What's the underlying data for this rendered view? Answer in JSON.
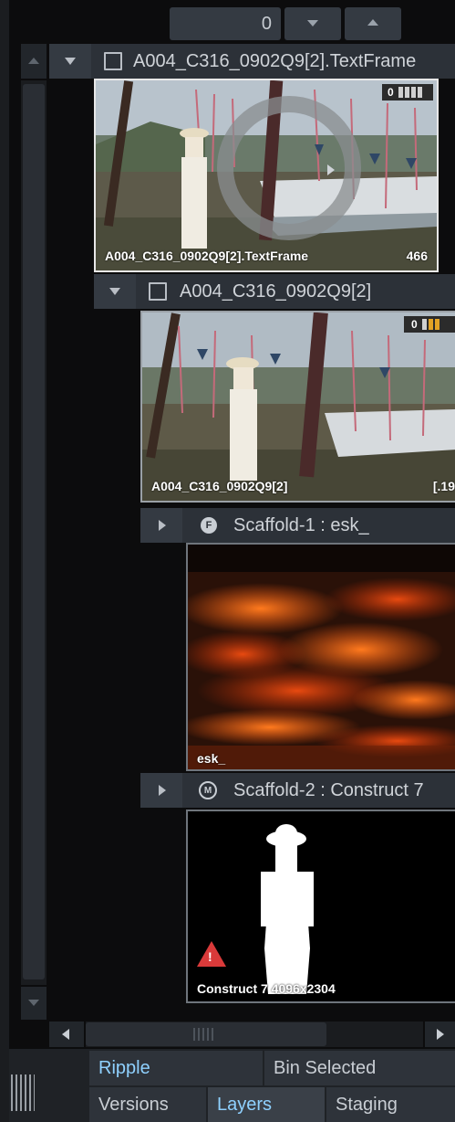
{
  "top_counter": {
    "value": "0"
  },
  "layers": [
    {
      "name": "A004_C316_0902Q9[2].TextFrame",
      "thumb_label": "A004_C316_0902Q9[2].TextFrame",
      "thumb_count": "466",
      "badge_value": "0"
    },
    {
      "name": "A004_C316_0902Q9[2]",
      "thumb_label": "A004_C316_0902Q9[2]",
      "thumb_count": "[.19",
      "badge_value": "0"
    },
    {
      "name": "Scaffold-1 : esk_",
      "icon_letter": "F",
      "thumb_label": "esk_"
    },
    {
      "name": "Scaffold-2 : Construct 7",
      "icon_letter": "M",
      "thumb_label": "Construct 7 4096x2304"
    }
  ],
  "tabs": {
    "row1": [
      "Ripple",
      "Bin Selected"
    ],
    "row2": [
      "Versions",
      "Layers",
      "Staging"
    ],
    "active": "Layers"
  },
  "colors": {
    "accent_text": "#8fd1ff",
    "warning": "#d93a3a"
  }
}
